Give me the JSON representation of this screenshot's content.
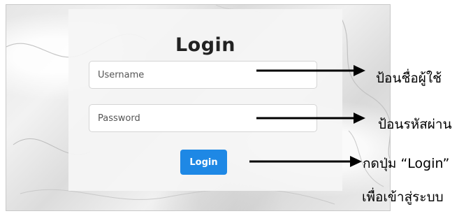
{
  "login_form": {
    "title": "Login",
    "username_placeholder": "Username",
    "password_placeholder": "Password",
    "button_label": "Login",
    "button_color": "#1e88e5"
  },
  "annotations": {
    "username_note": "ป้อนชื่อผู้ใช้",
    "password_note": "ป้อนรหัสผ่าน",
    "login_note_line1": "กดปุ่ม “Login”",
    "login_note_line2": "เพื่อเข้าสู่ระบบ"
  }
}
